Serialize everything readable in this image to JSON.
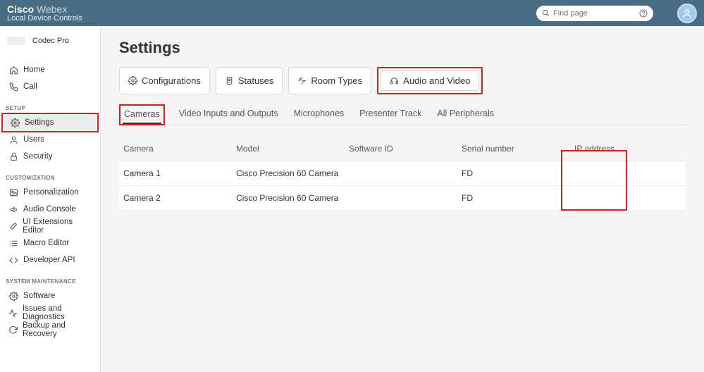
{
  "header": {
    "brand_bold": "Cisco",
    "brand_light": "Webex",
    "brand_sub": "Local Device Controls",
    "search_placeholder": "Find page"
  },
  "device": {
    "name": "Codec Pro"
  },
  "sidebar": {
    "top": [
      {
        "label": "Home",
        "icon": "home-icon"
      },
      {
        "label": "Call",
        "icon": "phone-icon"
      }
    ],
    "groups": [
      {
        "heading": "SETUP",
        "items": [
          {
            "label": "Settings",
            "icon": "gear-icon",
            "active": true,
            "highlight": true
          },
          {
            "label": "Users",
            "icon": "user-icon"
          },
          {
            "label": "Security",
            "icon": "lock-icon"
          }
        ]
      },
      {
        "heading": "CUSTOMIZATION",
        "items": [
          {
            "label": "Personalization",
            "icon": "image-icon"
          },
          {
            "label": "Audio Console",
            "icon": "sound-icon"
          },
          {
            "label": "UI Extensions Editor",
            "icon": "pencil-icon"
          },
          {
            "label": "Macro Editor",
            "icon": "list-icon"
          },
          {
            "label": "Developer API",
            "icon": "code-icon"
          }
        ]
      },
      {
        "heading": "SYSTEM MAINTENANCE",
        "items": [
          {
            "label": "Software",
            "icon": "gear-icon"
          },
          {
            "label": "Issues and Diagnostics",
            "icon": "pulse-icon"
          },
          {
            "label": "Backup and Recovery",
            "icon": "refresh-icon"
          }
        ]
      }
    ]
  },
  "page": {
    "title": "Settings"
  },
  "pills": [
    {
      "label": "Configurations",
      "icon": "gear-icon"
    },
    {
      "label": "Statuses",
      "icon": "doc-icon"
    },
    {
      "label": "Room Types",
      "icon": "sparkle-icon"
    },
    {
      "label": "Audio and Video",
      "icon": "headset-icon",
      "highlight": true
    }
  ],
  "tabs": [
    {
      "label": "Cameras",
      "active": true,
      "highlight": true
    },
    {
      "label": "Video Inputs and Outputs"
    },
    {
      "label": "Microphones"
    },
    {
      "label": "Presenter Track"
    },
    {
      "label": "All Peripherals"
    }
  ],
  "table": {
    "columns": [
      "Camera",
      "Model",
      "Software ID",
      "Serial number",
      "IP address"
    ],
    "rows": [
      {
        "camera": "Camera 1",
        "model": "Cisco Precision 60 Camera",
        "software_id": "",
        "serial": "FD",
        "ip": ""
      },
      {
        "camera": "Camera 2",
        "model": "Cisco Precision 60 Camera",
        "software_id": "",
        "serial": "FD",
        "ip": ""
      }
    ]
  }
}
